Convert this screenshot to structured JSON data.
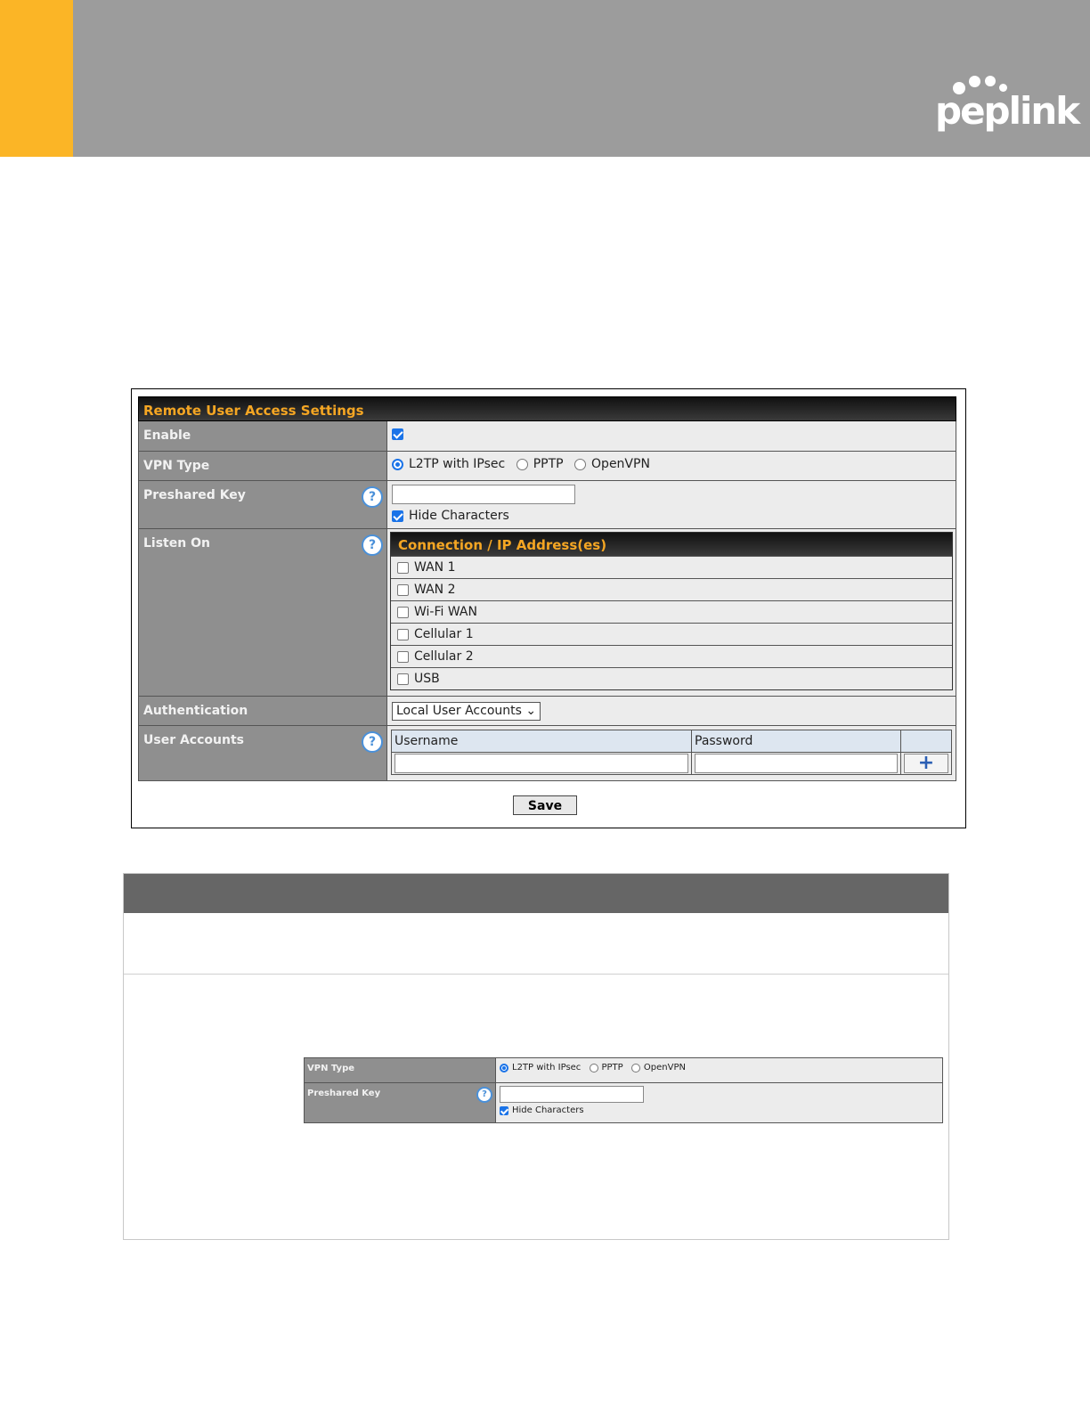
{
  "brand": {
    "logo_text": "peplink",
    "accent_color": "#fbb526",
    "banner_color": "#9c9c9c"
  },
  "panel": {
    "title": "Remote User Access Settings",
    "enable": {
      "label": "Enable",
      "checked": true
    },
    "vpn_type": {
      "label": "VPN Type",
      "options": [
        "L2TP with IPsec",
        "PPTP",
        "OpenVPN"
      ],
      "selected": "L2TP with IPsec"
    },
    "preshared_key": {
      "label": "Preshared Key",
      "value": "",
      "hide_characters_label": "Hide Characters",
      "hide_checked": true
    },
    "listen_on": {
      "label": "Listen On",
      "header": "Connection / IP Address(es)",
      "items": [
        "WAN 1",
        "WAN 2",
        "Wi-Fi WAN",
        "Cellular 1",
        "Cellular 2",
        "USB"
      ]
    },
    "authentication": {
      "label": "Authentication",
      "selected": "Local User Accounts"
    },
    "user_accounts": {
      "label": "User Accounts",
      "username_header": "Username",
      "password_header": "Password",
      "add_symbol": "+"
    },
    "save_label": "Save"
  },
  "mini": {
    "vpn_type_label": "VPN Type",
    "options": [
      "L2TP with IPsec",
      "PPTP",
      "OpenVPN"
    ],
    "preshared_key_label": "Preshared Key",
    "hide_characters_label": "Hide Characters"
  }
}
